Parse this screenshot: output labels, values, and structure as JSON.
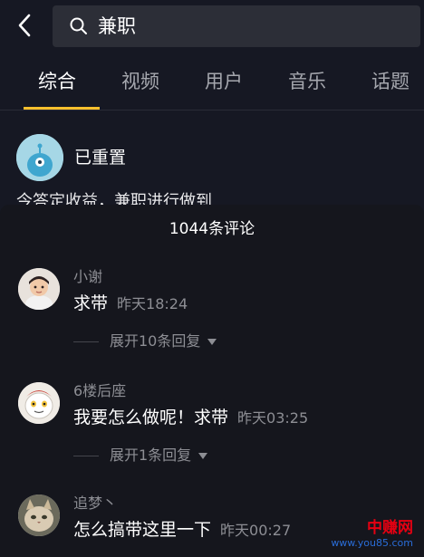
{
  "search": {
    "query": "兼职"
  },
  "tabs": [
    {
      "label": "综合",
      "active": true
    },
    {
      "label": "视频",
      "active": false
    },
    {
      "label": "用户",
      "active": false
    },
    {
      "label": "音乐",
      "active": false
    },
    {
      "label": "话题",
      "active": false
    }
  ],
  "result": {
    "name": "已重置",
    "desc": "今答定收益，兼职进行做到"
  },
  "comments_panel": {
    "title": "1044条评论",
    "comments": [
      {
        "author": "小谢",
        "text": "求带",
        "time": "昨天18:24",
        "replies": "展开10条回复"
      },
      {
        "author": "6楼后座",
        "text": "我要怎么做呢！求带",
        "time": "昨天03:25",
        "replies": "展开1条回复"
      },
      {
        "author": "追梦丶",
        "text": "怎么搞带这里一下",
        "time": "昨天00:27",
        "replies": ""
      }
    ]
  },
  "watermark": {
    "main": "中赚网",
    "sub": "www.you85.com"
  },
  "colors": {
    "background": "#161823",
    "panel": "#15161d",
    "accent": "#fdc02d",
    "muted_text": "#8d8e94"
  },
  "icons": {
    "back": "chevron-left-icon",
    "search": "search-icon",
    "expand": "caret-down-icon"
  }
}
